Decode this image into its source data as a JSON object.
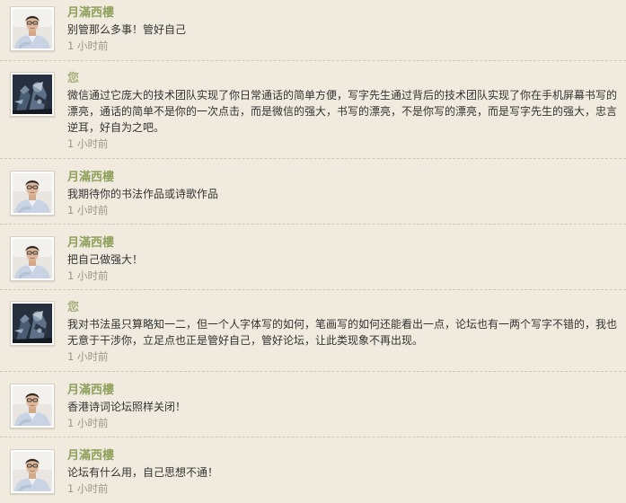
{
  "colors": {
    "background": "#f0ebde",
    "author_name": "#8fa05c",
    "own_name": "#a7b07c",
    "message_text": "#333333",
    "timestamp": "#9a958a",
    "divider": "#cfc7b3"
  },
  "messages": [
    {
      "author": "月滿西樓",
      "avatar_icon": "man-portrait-avatar",
      "text": "别管那么多事！管好自己",
      "time": "1 小时前"
    },
    {
      "author": "您",
      "avatar_icon": "game-character-avatar",
      "text": "微信通过它庞大的技术团队实现了你日常通话的简单方便，写字先生通过背后的技术团队实现了你在手机屏幕书写的漂亮，通话的简单不是你的一次点击，而是微信的强大，书写的漂亮，不是你写的漂亮，而是写字先生的强大，忠言逆耳，好自为之吧。",
      "time": "1 小时前"
    },
    {
      "author": "月滿西樓",
      "avatar_icon": "man-portrait-avatar",
      "text": "我期待你的书法作品或诗歌作品",
      "time": "1 小时前"
    },
    {
      "author": "月滿西樓",
      "avatar_icon": "man-portrait-avatar",
      "text": "把自己做强大！",
      "time": "1 小时前"
    },
    {
      "author": "您",
      "avatar_icon": "game-character-avatar",
      "text": "我对书法虽只算略知一二，但一个人字体写的如何，笔画写的如何还能看出一点，论坛也有一两个写字不错的，我也无意于干涉你，立足点也正是管好自己，管好论坛，让此类现象不再出现。",
      "time": "1 小时前"
    },
    {
      "author": "月滿西樓",
      "avatar_icon": "man-portrait-avatar",
      "text": "香港诗词论坛照样关闭！",
      "time": "1 小时前"
    },
    {
      "author": "月滿西樓",
      "avatar_icon": "man-portrait-avatar",
      "text": "论坛有什么用，自己思想不通！",
      "time": "1 小时前"
    }
  ]
}
